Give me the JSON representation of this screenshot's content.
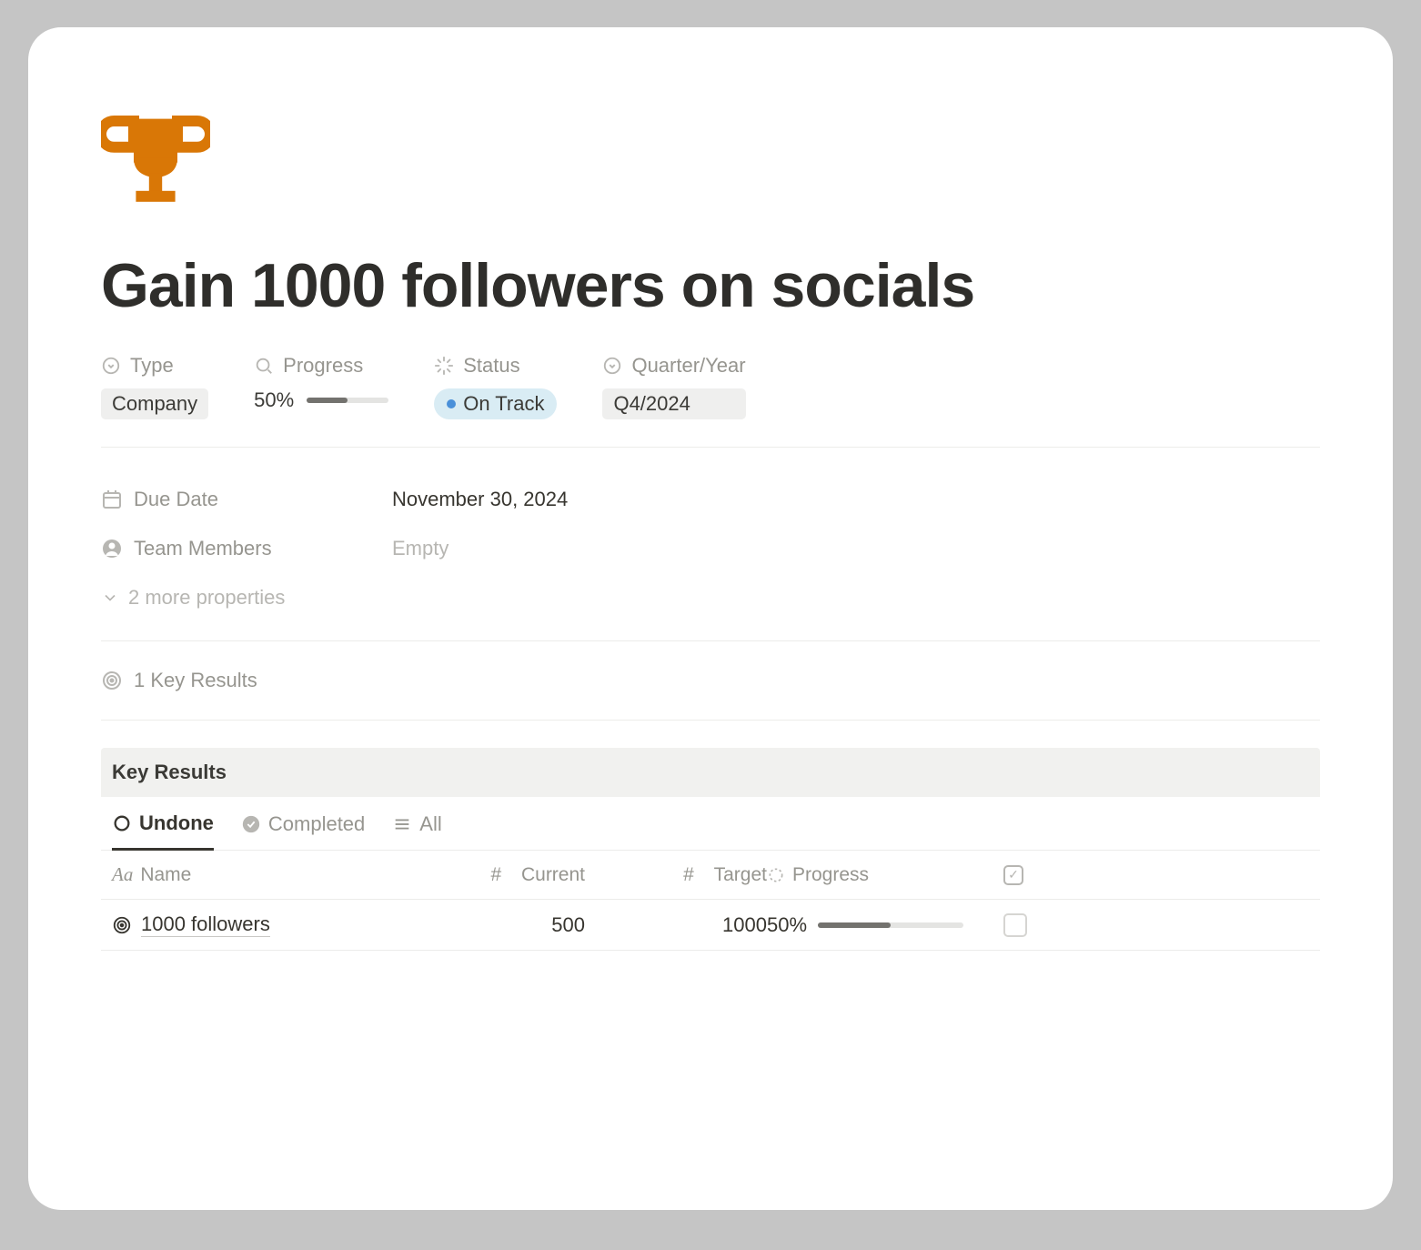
{
  "page": {
    "title": "Gain 1000 followers on socials",
    "icon": "trophy"
  },
  "properties": {
    "type": {
      "label": "Type",
      "value": "Company"
    },
    "progress": {
      "label": "Progress",
      "percent_text": "50%",
      "percent": 50
    },
    "status": {
      "label": "Status",
      "value": "On Track",
      "color": "#4a90d9"
    },
    "quarter": {
      "label": "Quarter/Year",
      "value": "Q4/2024"
    }
  },
  "details": {
    "due_date": {
      "label": "Due Date",
      "value": "November 30, 2024"
    },
    "team_members": {
      "label": "Team Members",
      "value": "Empty",
      "is_empty": true
    },
    "more_label": "2 more properties"
  },
  "relation": {
    "label": "1 Key Results"
  },
  "key_results": {
    "heading": "Key Results",
    "tabs": {
      "undone": "Undone",
      "completed": "Completed",
      "all": "All",
      "active": "undone"
    },
    "columns": {
      "name": "Name",
      "current": "Current",
      "target": "Target",
      "progress": "Progress"
    },
    "rows": [
      {
        "name": "1000 followers",
        "current": "500",
        "target": "1000",
        "progress_text": "50%",
        "progress": 50,
        "checked": false
      }
    ]
  }
}
